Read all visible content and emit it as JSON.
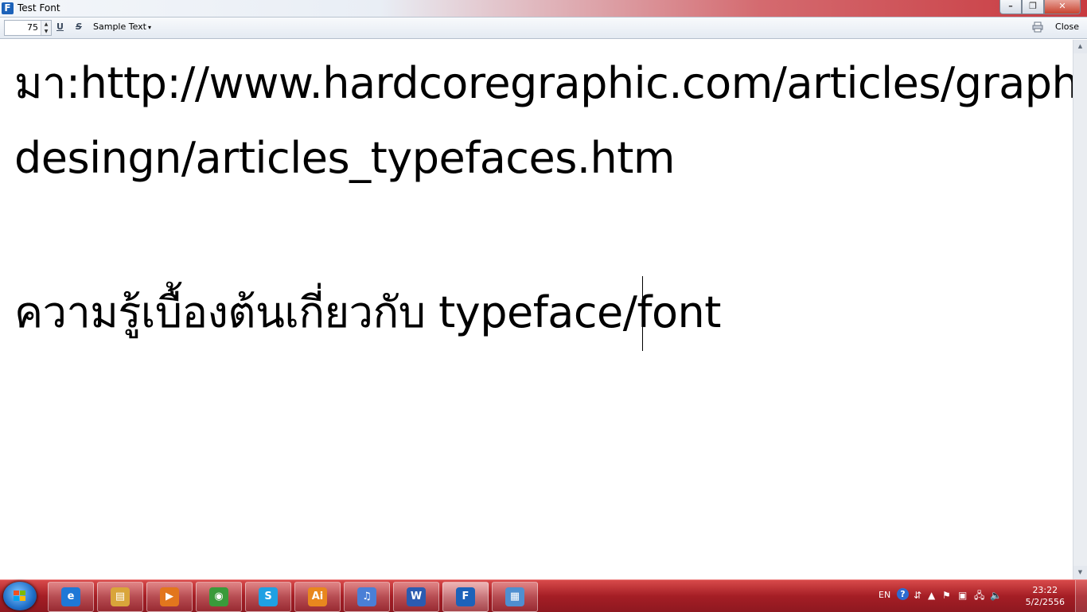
{
  "window": {
    "title": "Test Font",
    "app_icon_letter": "F",
    "buttons": {
      "minimize": "–",
      "maximize": "❐",
      "close": "✕"
    }
  },
  "toolbar": {
    "font_size": "75",
    "underline_label": "U",
    "strike_label": "S",
    "sample_text_label": "Sample Text",
    "caret": "▾",
    "close_label": "Close"
  },
  "content": {
    "lines": [
      "มา:http://www.hardcoregraphic.com/articles/graphic_",
      "desingn/articles_typefaces.htm",
      "ความรู้เบื้องต้นเกี่ยวกับ typeface/font"
    ]
  },
  "taskbar": {
    "apps": [
      {
        "name": "internet-explorer",
        "glyph": "e",
        "color": "#1e78d6"
      },
      {
        "name": "file-explorer",
        "glyph": "▤",
        "color": "#d9a53a"
      },
      {
        "name": "media-player",
        "glyph": "▶",
        "color": "#e2761d"
      },
      {
        "name": "chrome",
        "glyph": "◉",
        "color": "#3a9a3a"
      },
      {
        "name": "skype",
        "glyph": "S",
        "color": "#1fa0e3"
      },
      {
        "name": "illustrator",
        "glyph": "Ai",
        "color": "#e8871e"
      },
      {
        "name": "itunes",
        "glyph": "♫",
        "color": "#4a7fd6"
      },
      {
        "name": "word",
        "glyph": "W",
        "color": "#2b5bb0"
      },
      {
        "name": "font-creator",
        "glyph": "F",
        "color": "#1c62b9"
      },
      {
        "name": "control-panel",
        "glyph": "▦",
        "color": "#4f8fd0"
      }
    ],
    "tray": {
      "language": "EN",
      "help": "?",
      "time": "23:22",
      "date": "5/2/2556"
    }
  }
}
